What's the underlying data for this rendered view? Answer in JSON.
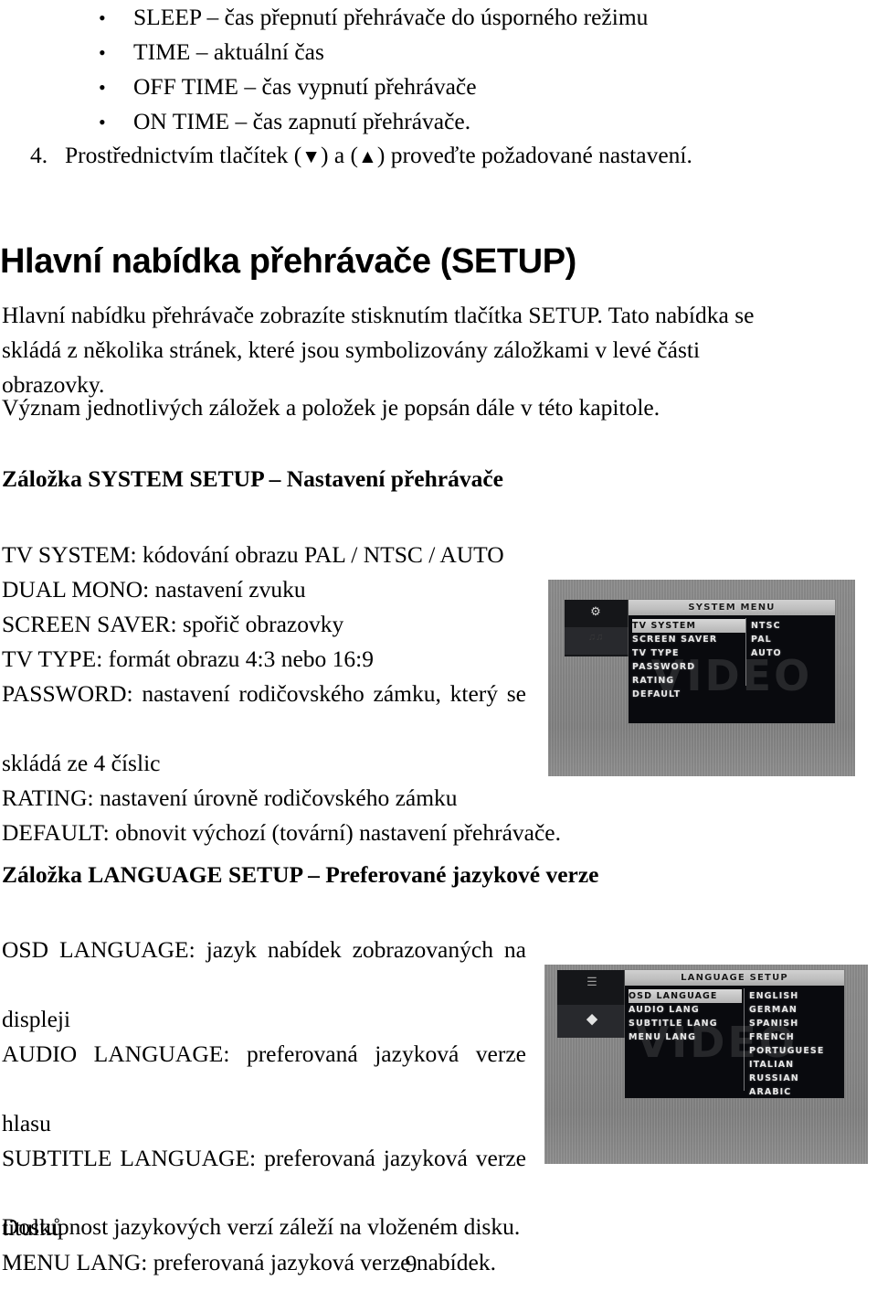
{
  "bullets": [
    {
      "text": "SLEEP – čas přepnutí přehrávače do úsporného režimu",
      "marker": "•"
    },
    {
      "text": "TIME – aktuální čas",
      "marker": "•"
    },
    {
      "text": "OFF TIME – čas vypnutí přehrávače",
      "marker": "•"
    },
    {
      "text": "ON TIME – čas zapnutí přehrávače.",
      "marker": "•"
    }
  ],
  "numbered_item": {
    "number": "4.",
    "text_before": "Prostřednictvím tlačítek (",
    "down_arrow": "▼",
    "text_middle": ") a (",
    "up_arrow": "▲",
    "text_after": ") proveďte požadované nastavení."
  },
  "heading": "Hlavní nabídka přehrávače (SETUP)",
  "intro_paragraph": {
    "line1": "Hlavní nabídku přehrávače zobrazíte stisknutím tlačítka SETUP. Tato nabídka se",
    "line2": "skládá z několika stránek, které jsou symbolizovány záložkami v levé části",
    "line3": "obrazovky."
  },
  "vyznam_paragraph": "Význam jednotlivých záložek a položek je popsán dále v této kapitole.",
  "system_section": {
    "heading": "Záložka SYSTEM SETUP – Nastavení přehrávače",
    "items": [
      "TV SYSTEM: kódování obrazu PAL / NTSC / AUTO",
      "DUAL MONO: nastavení zvuku",
      "SCREEN SAVER: spořič obrazovky",
      "TV TYPE: formát obrazu 4:3 nebo 16:9",
      "PASSWORD: nastavení rodičovského zámku, který se",
      "skládá ze 4 číslic",
      "RATING: nastavení úrovně rodičovského zámku",
      "DEFAULT: obnovit výchozí (tovární) nastavení přehrávače."
    ]
  },
  "language_section": {
    "heading": "Záložka LANGUAGE SETUP – Preferované jazykové verze",
    "items": [
      "OSD LANGUAGE: jazyk nabídek zobrazovaných na",
      "displeji",
      "AUDIO LANGUAGE: preferovaná jazyková verze",
      "hlasu",
      "SUBTITLE LANGUAGE: preferovaná jazyková verze",
      "titulků",
      "MENU LANG: preferovaná jazyková verze nabídek."
    ]
  },
  "trailing_note": "Dostupnost jazykových verzí záleží na vloženém disku.",
  "page_number": "9",
  "osd_screenshot_system": {
    "title": "SYSTEM MENU",
    "watermark": "VIDEO",
    "menu_items": [
      "TV SYSTEM",
      "SCREEN SAVER",
      "TV TYPE",
      "PASSWORD",
      "RATING",
      "DEFAULT"
    ],
    "selected_item": "TV SYSTEM",
    "values": [
      "NTSC",
      "PAL",
      "AUTO"
    ],
    "tab_icons": [
      "system-tab-icon",
      "audio-tab-icon"
    ]
  },
  "osd_screenshot_language": {
    "title": "LANGUAGE SETUP",
    "watermark": "VIDEO",
    "menu_items": [
      "OSD LANGUAGE",
      "AUDIO LANG",
      "SUBTITLE LANG",
      "MENU LANG"
    ],
    "selected_item": "OSD LANGUAGE",
    "values": [
      "ENGLISH",
      "GERMAN",
      "SPANISH",
      "FRENCH",
      "PORTUGUESE",
      "ITALIAN",
      "RUSSIAN",
      "ARABIC"
    ],
    "tab_icons": [
      "language-tab-icon",
      "globe-tab-icon"
    ]
  },
  "colors": {
    "text": "#000000",
    "osd_panel": "#0b0c10",
    "osd_highlight": "#c8c8c8",
    "osd_background": "#8a8a8a"
  }
}
